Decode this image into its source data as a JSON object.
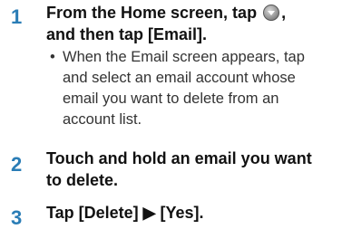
{
  "steps": [
    {
      "number": "1",
      "title_before_icon": "From the Home screen, tap",
      "icon": "menu-circle-icon",
      "title_after_icon": ",",
      "title_line2": "and then tap [Email].",
      "bullet": "•",
      "sub": [
        "When the Email screen appears, tap",
        "and select an email account whose",
        "email you want to delete from an",
        "account list."
      ]
    },
    {
      "number": "2",
      "title_lines": [
        "Touch and hold an email you want",
        "to delete."
      ]
    },
    {
      "number": "3",
      "title": "Tap [Delete] ▶ [Yes]."
    }
  ]
}
